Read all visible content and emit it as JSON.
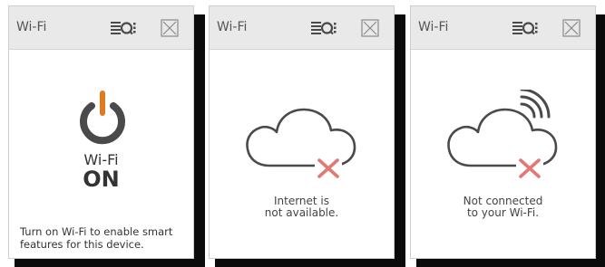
{
  "colors": {
    "accent": "#e07a1f",
    "icon": "#4a4a4a",
    "error_x": "#e07a73",
    "titlebar": "#e9e9e9"
  },
  "icons": {
    "menu": "list-menu-icon",
    "close": "close-icon",
    "power": "power-icon",
    "cloud": "cloud-icon",
    "error": "x-mark-icon",
    "signal": "wifi-signal-icon"
  },
  "panels": [
    {
      "title": "Wi-Fi",
      "status_line1": "Wi-Fi",
      "status_line2": "ON",
      "note": "Turn on Wi-Fi to enable smart\nfeatures for this device."
    },
    {
      "title": "Wi-Fi",
      "message": "Internet is\nnot available."
    },
    {
      "title": "Wi-Fi",
      "message": "Not connected\nto your Wi-Fi."
    }
  ]
}
